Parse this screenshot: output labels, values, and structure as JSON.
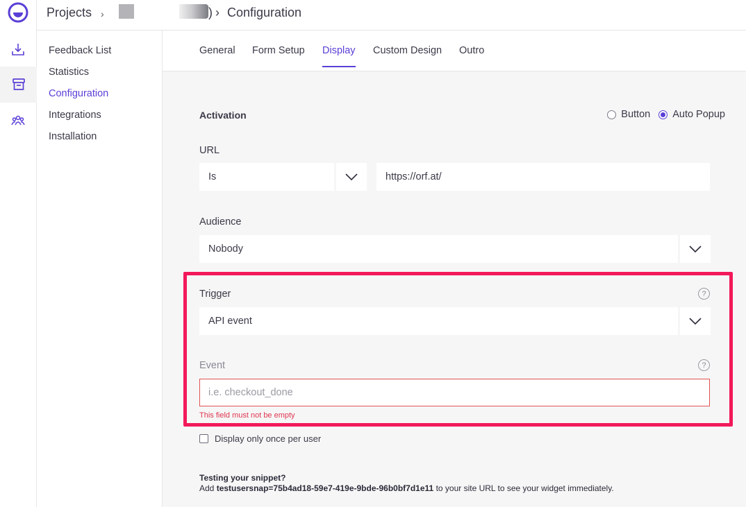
{
  "colors": {
    "accent": "#5a3fd6",
    "error": "#e0354f",
    "highlight": "#f2195a"
  },
  "rail": {
    "icons": [
      "logo-icon",
      "download-icon",
      "inbox-icon",
      "team-icon"
    ]
  },
  "breadcrumb": {
    "projects": "Projects",
    "sep1": "›",
    "paren": ")",
    "sep2": "›",
    "current": "Configuration"
  },
  "subnav": {
    "items": [
      {
        "label": "Feedback List"
      },
      {
        "label": "Statistics"
      },
      {
        "label": "Configuration",
        "active": true
      },
      {
        "label": "Integrations"
      },
      {
        "label": "Installation"
      }
    ]
  },
  "tabs": [
    {
      "label": "General"
    },
    {
      "label": "Form Setup"
    },
    {
      "label": "Display",
      "active": true
    },
    {
      "label": "Custom Design"
    },
    {
      "label": "Outro"
    }
  ],
  "activation": {
    "label": "Activation",
    "options": [
      {
        "label": "Button",
        "selected": false
      },
      {
        "label": "Auto Popup",
        "selected": true
      }
    ]
  },
  "url": {
    "label": "URL",
    "operator": "Is",
    "value": "https://orf.at/"
  },
  "audience": {
    "label": "Audience",
    "value": "Nobody"
  },
  "trigger": {
    "label": "Trigger",
    "value": "API event",
    "help": "?"
  },
  "event": {
    "label": "Event",
    "placeholder": "i.e. checkout_done",
    "value": "",
    "error": "This field must not be empty",
    "help": "?"
  },
  "display_once": {
    "label": "Display only once per user",
    "checked": false
  },
  "snippet": {
    "title": "Testing your snippet?",
    "prefix": "Add",
    "param": "testusersnap=75b4ad18-59e7-419e-9bde-96b0bf7d1e11",
    "suffix": "to your site URL to see your widget immediately."
  }
}
